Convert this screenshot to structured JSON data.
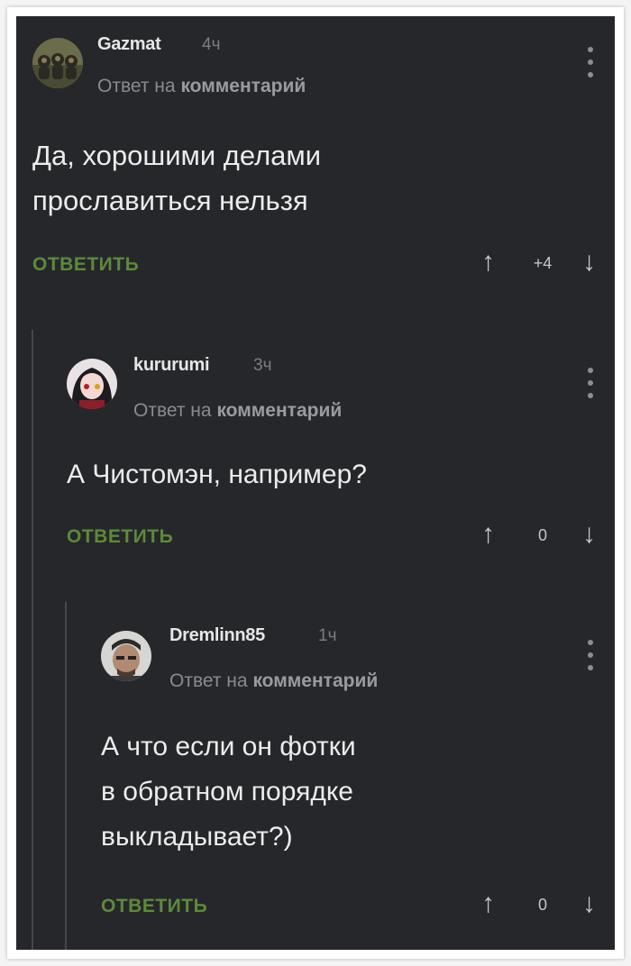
{
  "comments": [
    {
      "username": "Gazmat",
      "time": "4ч",
      "reply_prefix": "Ответ на",
      "reply_target": "комментарий",
      "text": "Да, хорошими делами\nпрославиться нельзя",
      "reply_label": "ОТВЕТИТЬ",
      "score": "+4",
      "avatar_icon": "three-monkeys-avatar"
    },
    {
      "username": "kururumi",
      "time": "3ч",
      "reply_prefix": "Ответ на",
      "reply_target": "комментарий",
      "text": "А Чистомэн, например?",
      "reply_label": "ОТВЕТИТЬ",
      "score": "0",
      "avatar_icon": "anime-girl-avatar"
    },
    {
      "username": "Dremlinn85",
      "time": "1ч",
      "reply_prefix": "Ответ на",
      "reply_target": "комментарий",
      "text": "А что если он фотки\nв обратном порядке\nвыкладывает?)",
      "reply_label": "ОТВЕТИТЬ",
      "score": "0",
      "avatar_icon": "man-photo-avatar"
    }
  ],
  "icons": {
    "upvote": "↑",
    "downvote": "↓"
  },
  "colors": {
    "background": "#26272b",
    "reply_accent": "#5c8a3a",
    "text": "#ececec"
  }
}
